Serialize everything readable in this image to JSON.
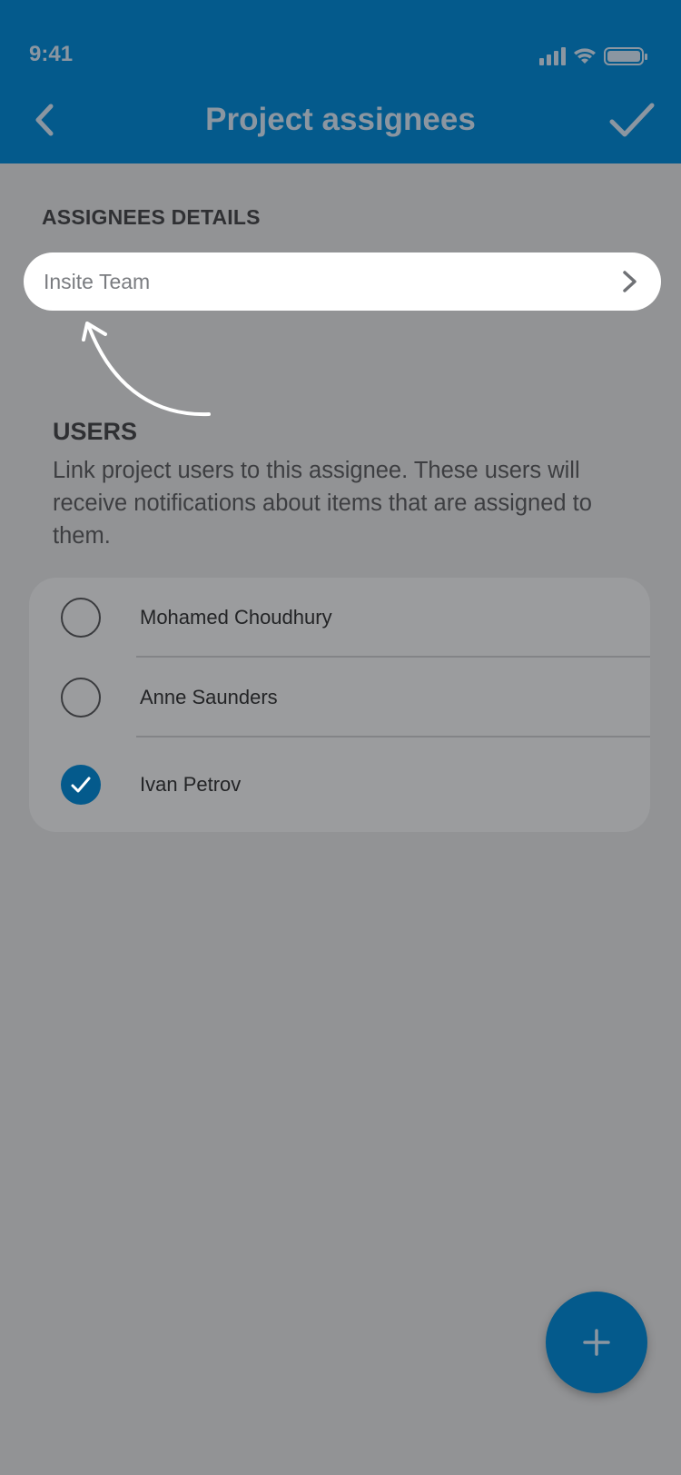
{
  "status_bar": {
    "time": "9:41",
    "icons": [
      "signal-icon",
      "wifi-icon",
      "battery-icon"
    ]
  },
  "header": {
    "title": "Project assignees",
    "back_icon": "chevron-left-icon",
    "confirm_icon": "checkmark-icon"
  },
  "assignee_details": {
    "section_label": "ASSIGNEES DETAILS",
    "value": "Insite Team",
    "chevron_icon": "chevron-right-icon"
  },
  "users": {
    "title": "USERS",
    "description": "Link project users to this assignee. These users will receive notifications about items that are assigned to them.",
    "items": [
      {
        "name": "Mohamed Choudhury",
        "checked": false
      },
      {
        "name": "Anne Saunders",
        "checked": false
      },
      {
        "name": "Ivan Petrov",
        "checked": true
      }
    ]
  },
  "fab": {
    "icon": "plus-icon"
  },
  "colors": {
    "brand": "#045a8c",
    "overlay_background": "#929395"
  }
}
